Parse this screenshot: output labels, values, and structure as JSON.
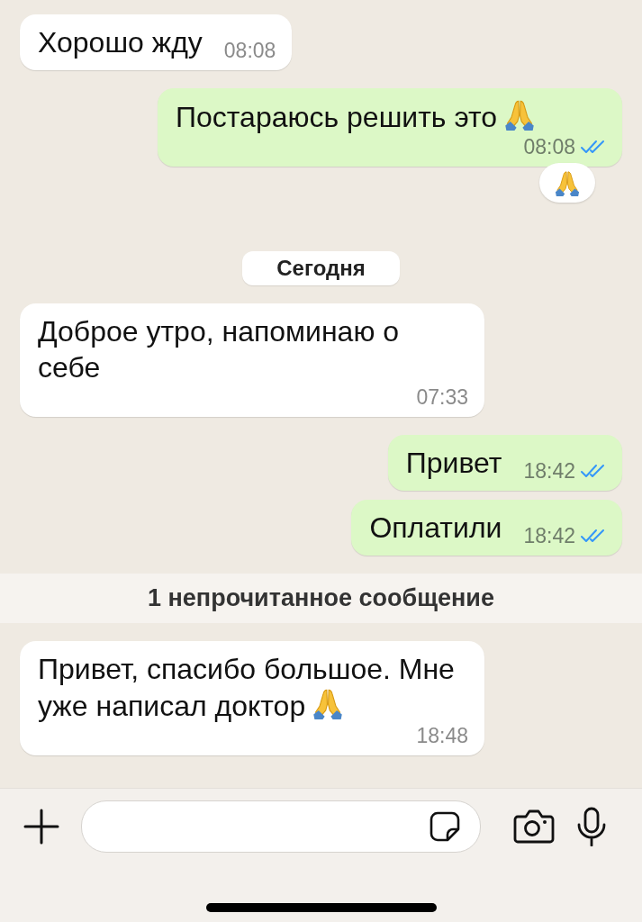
{
  "messages": [
    {
      "kind": "incoming",
      "text": "Хорошо жду",
      "time": "08:08"
    },
    {
      "kind": "outgoing",
      "text": "Постараюсь решить это",
      "emoji": true,
      "time": "08:08",
      "read": true,
      "reaction": true
    },
    {
      "kind": "date",
      "text": "Сегодня"
    },
    {
      "kind": "incoming",
      "text": "Доброе утро, напоминаю о себе",
      "time": "07:33"
    },
    {
      "kind": "outgoing",
      "text": "Привет",
      "time": "18:42",
      "read": true
    },
    {
      "kind": "outgoing",
      "text": "Оплатили",
      "time": "18:42",
      "read": true,
      "grouped": true
    },
    {
      "kind": "unread",
      "text": "1 непрочитанное сообщение"
    },
    {
      "kind": "incoming",
      "text": "Привет, спасибо большое. Мне уже написал доктор",
      "emoji": true,
      "time": "18:48"
    }
  ]
}
